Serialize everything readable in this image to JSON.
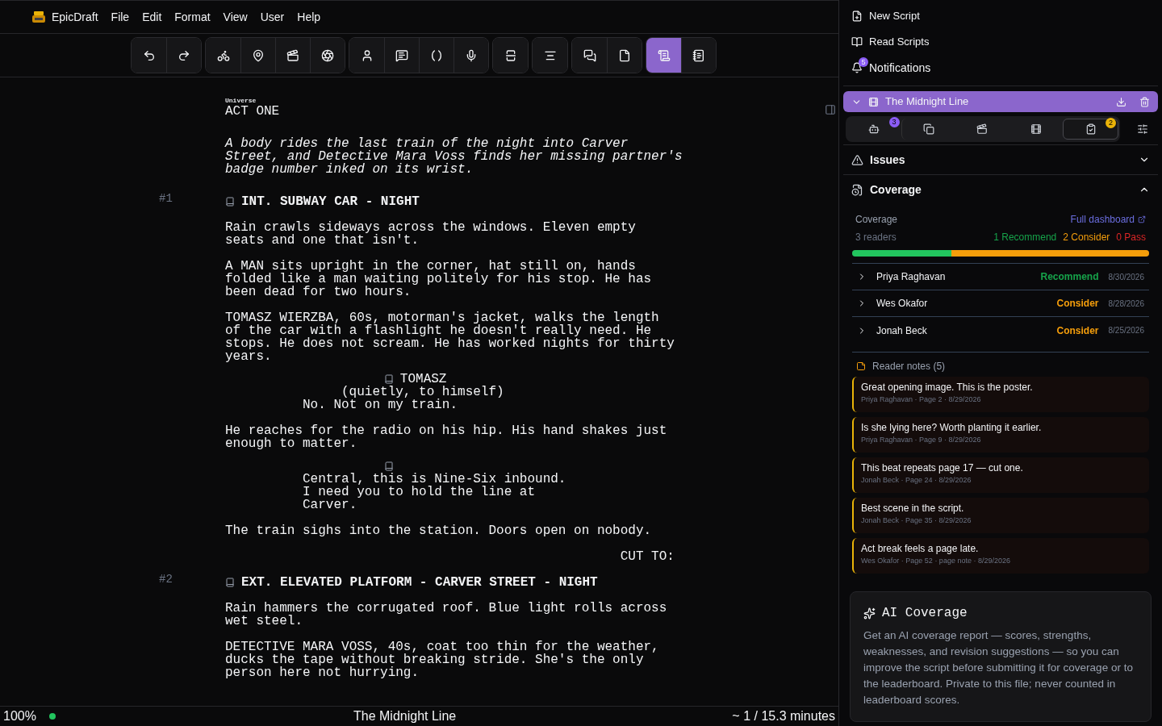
{
  "menu": {
    "app": "EpicDraft",
    "items": [
      "File",
      "Edit",
      "Format",
      "View",
      "User",
      "Help"
    ]
  },
  "toolbar": [
    [
      {
        "selected": false
      },
      {
        "selected": false
      }
    ],
    [
      {
        "selected": false
      },
      {
        "selected": false
      },
      {
        "selected": false
      },
      {
        "selected": false
      }
    ],
    [
      {
        "selected": false
      },
      {
        "selected": false
      },
      {
        "selected": false
      },
      {
        "selected": false
      }
    ],
    [
      {
        "selected": false
      }
    ],
    [
      {
        "selected": false
      }
    ],
    [
      {
        "selected": false
      },
      {
        "selected": false
      }
    ],
    [
      {
        "selected": true
      },
      {
        "selected": false
      }
    ]
  ],
  "script": [
    {
      "kind": "act",
      "label": "Universe",
      "title": "ACT ONE"
    },
    {
      "kind": "synopsis",
      "text": "A body rides the last train of the night into Carver Street, and Detective Mara Voss finds her missing partner's badge number inked on its wrist."
    },
    {
      "kind": "scene",
      "number": "#1",
      "text": "INT. SUBWAY CAR - NIGHT"
    },
    {
      "kind": "action",
      "text": "Rain crawls sideways across the windows. Eleven empty seats and one that isn't."
    },
    {
      "kind": "action",
      "text": "A MAN sits upright in the corner, hat still on, hands folded like a man waiting politely for his stop. He has been dead for two hours."
    },
    {
      "kind": "action",
      "text": "TOMASZ WIERZBA, 60s, motorman's jacket, walks the length of the car with a flashlight he doesn't really need. He stops. He does not scream. He has worked nights for thirty years."
    },
    {
      "kind": "dialogue",
      "character": "TOMASZ",
      "parenthetical": "(quietly, to himself)",
      "lines": "No. Not on my train."
    },
    {
      "kind": "action",
      "text": "He reaches for the radio on his hip. His hand shakes just enough to matter."
    },
    {
      "kind": "dialogue",
      "lines": "Central, this is Nine-Six inbound. I need you to hold the line at Carver."
    },
    {
      "kind": "action",
      "text": "The train sighs into the station. Doors open on nobody."
    },
    {
      "kind": "transition",
      "text": "CUT TO:"
    },
    {
      "kind": "scene",
      "number": "#2",
      "text": "EXT. ELEVATED PLATFORM - CARVER STREET - NIGHT"
    },
    {
      "kind": "action",
      "text": "Rain hammers the corrugated roof. Blue light rolls across wet steel."
    },
    {
      "kind": "action",
      "text": "DETECTIVE MARA VOSS, 40s, coat too thin for the weather, ducks the tape without breaking stride. She's the only person here not hurrying."
    }
  ],
  "status_bar": {
    "zoom": "100%",
    "online": true,
    "title": "The Midnight Line",
    "duration": "~ 1 / 15.3 minutes"
  },
  "sidebar": {
    "nav": [
      {
        "label": "New Script"
      },
      {
        "label": "Read Scripts"
      },
      {
        "label": "Notifications",
        "badge": "5"
      }
    ],
    "project": {
      "title": "The Midnight Line",
      "expanded": true
    },
    "tabs": [
      {
        "selected": false,
        "badge": "3",
        "color": "#8b5cf6"
      },
      {
        "selected": false
      },
      {
        "selected": false
      },
      {
        "selected": false
      },
      {
        "selected": true,
        "badge": "2",
        "color": "#eab308"
      }
    ],
    "sections": [
      {
        "title": "Issues",
        "expanded": false
      },
      {
        "title": "Coverage",
        "expanded": true
      }
    ],
    "coverage": {
      "label": "Coverage",
      "link": "Full dashboard",
      "readers": "3 readers",
      "counts": [
        {
          "text": "1 Recommend",
          "color": "#16a34a"
        },
        {
          "text": "2 Consider",
          "color": "#f59e0b"
        },
        {
          "text": "0 Pass",
          "color": "#dc2626"
        }
      ],
      "bar": [
        {
          "level": 0.333,
          "color": "#22c55e"
        },
        {
          "level": 0.667,
          "color": "#f59e0b"
        }
      ],
      "reviews": [
        {
          "name": "Priya Raghavan",
          "verdict": "Recommend",
          "color": "#16a34a",
          "date": "8/30/2026"
        },
        {
          "name": "Wes Okafor",
          "verdict": "Consider",
          "color": "#f59e0b",
          "date": "8/28/2026"
        },
        {
          "name": "Jonah Beck",
          "verdict": "Consider",
          "color": "#f59e0b",
          "date": "8/25/2026"
        }
      ],
      "notes_title": "Reader notes (5)",
      "notes": [
        {
          "text": "Great opening image. This is the poster.",
          "meta": "Priya Raghavan · Page 2 · 8/29/2026"
        },
        {
          "text": "Is she lying here? Worth planting it earlier.",
          "meta": "Priya Raghavan · Page 9 · 8/29/2026"
        },
        {
          "text": "This beat repeats page 17 — cut one.",
          "meta": "Jonah Beck · Page 24 · 8/29/2026"
        },
        {
          "text": "Best scene in the script.",
          "meta": "Jonah Beck · Page 35 · 8/29/2026"
        },
        {
          "text": "Act break feels a page late.",
          "meta": "Wes Okafor · Page 52 · page note · 8/29/2026"
        }
      ]
    },
    "ai": {
      "title": "AI Coverage",
      "text": "Get an AI coverage report — scores, strengths, weaknesses, and revision suggestions — so you can improve the script before submitting it for coverage or to the leaderboard. Private to this file; never counted in leaderboard scores."
    }
  }
}
